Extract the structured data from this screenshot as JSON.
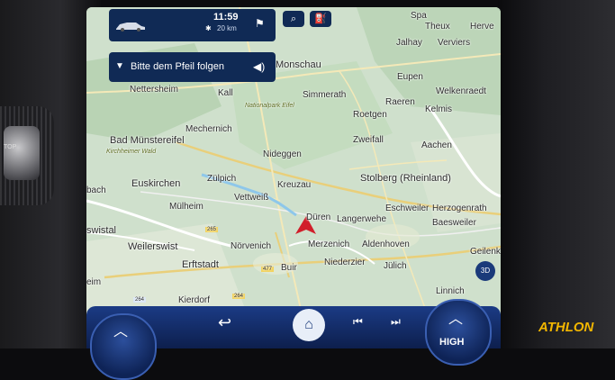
{
  "status": {
    "time": "11:59",
    "distance": "20 km"
  },
  "guidance": {
    "instruction": "Bitte dem Pfeil folgen"
  },
  "map": {
    "places": [
      {
        "name": "Monschau",
        "cls": "big"
      },
      {
        "name": "Nettersheim",
        "cls": ""
      },
      {
        "name": "Kall",
        "cls": ""
      },
      {
        "name": "Simmerath",
        "cls": ""
      },
      {
        "name": "Eupen",
        "cls": ""
      },
      {
        "name": "Welkenraedt",
        "cls": ""
      },
      {
        "name": "Raeren",
        "cls": ""
      },
      {
        "name": "Kelmis",
        "cls": ""
      },
      {
        "name": "Roetgen",
        "cls": ""
      },
      {
        "name": "Nationalpark Eifel",
        "cls": "park"
      },
      {
        "name": "Mechernich",
        "cls": ""
      },
      {
        "name": "Bad Münstereifel",
        "cls": "big"
      },
      {
        "name": "Kirchheimer Wald",
        "cls": "park"
      },
      {
        "name": "Zweifall",
        "cls": ""
      },
      {
        "name": "Aachen",
        "cls": ""
      },
      {
        "name": "Nideggen",
        "cls": ""
      },
      {
        "name": "Euskirchen",
        "cls": "big"
      },
      {
        "name": "Zülpich",
        "cls": ""
      },
      {
        "name": "Kreuzau",
        "cls": ""
      },
      {
        "name": "Stolberg (Rheinland)",
        "cls": "big"
      },
      {
        "name": "Vettweiß",
        "cls": ""
      },
      {
        "name": "Mülheim",
        "cls": ""
      },
      {
        "name": "Düren",
        "cls": ""
      },
      {
        "name": "Langerwehe",
        "cls": ""
      },
      {
        "name": "Eschweiler",
        "cls": ""
      },
      {
        "name": "Herzogenrath",
        "cls": ""
      },
      {
        "name": "Baesweiler",
        "cls": ""
      },
      {
        "name": "Weilerswist",
        "cls": "big"
      },
      {
        "name": "Nörvenich",
        "cls": ""
      },
      {
        "name": "Merzenich",
        "cls": ""
      },
      {
        "name": "Aldenhoven",
        "cls": ""
      },
      {
        "name": "Erftstadt",
        "cls": "big"
      },
      {
        "name": "Buir",
        "cls": ""
      },
      {
        "name": "Niederzier",
        "cls": ""
      },
      {
        "name": "Jülich",
        "cls": ""
      },
      {
        "name": "Geilenk",
        "cls": ""
      },
      {
        "name": "Kierdorf",
        "cls": ""
      },
      {
        "name": "Linnich",
        "cls": ""
      },
      {
        "name": "Jalhay",
        "cls": ""
      },
      {
        "name": "Verviers",
        "cls": ""
      },
      {
        "name": "Spa",
        "cls": ""
      },
      {
        "name": "Theux",
        "cls": ""
      },
      {
        "name": "Herve",
        "cls": ""
      },
      {
        "name": "bach",
        "cls": ""
      },
      {
        "name": "swistal",
        "cls": "big"
      },
      {
        "name": "eim",
        "cls": ""
      }
    ],
    "roads": [
      "265",
      "264",
      "477",
      "264"
    ],
    "zoom_label": "3D"
  },
  "controls": {
    "knob_right_label": "HIGH"
  },
  "branding": {
    "logo": "ATHLON"
  }
}
